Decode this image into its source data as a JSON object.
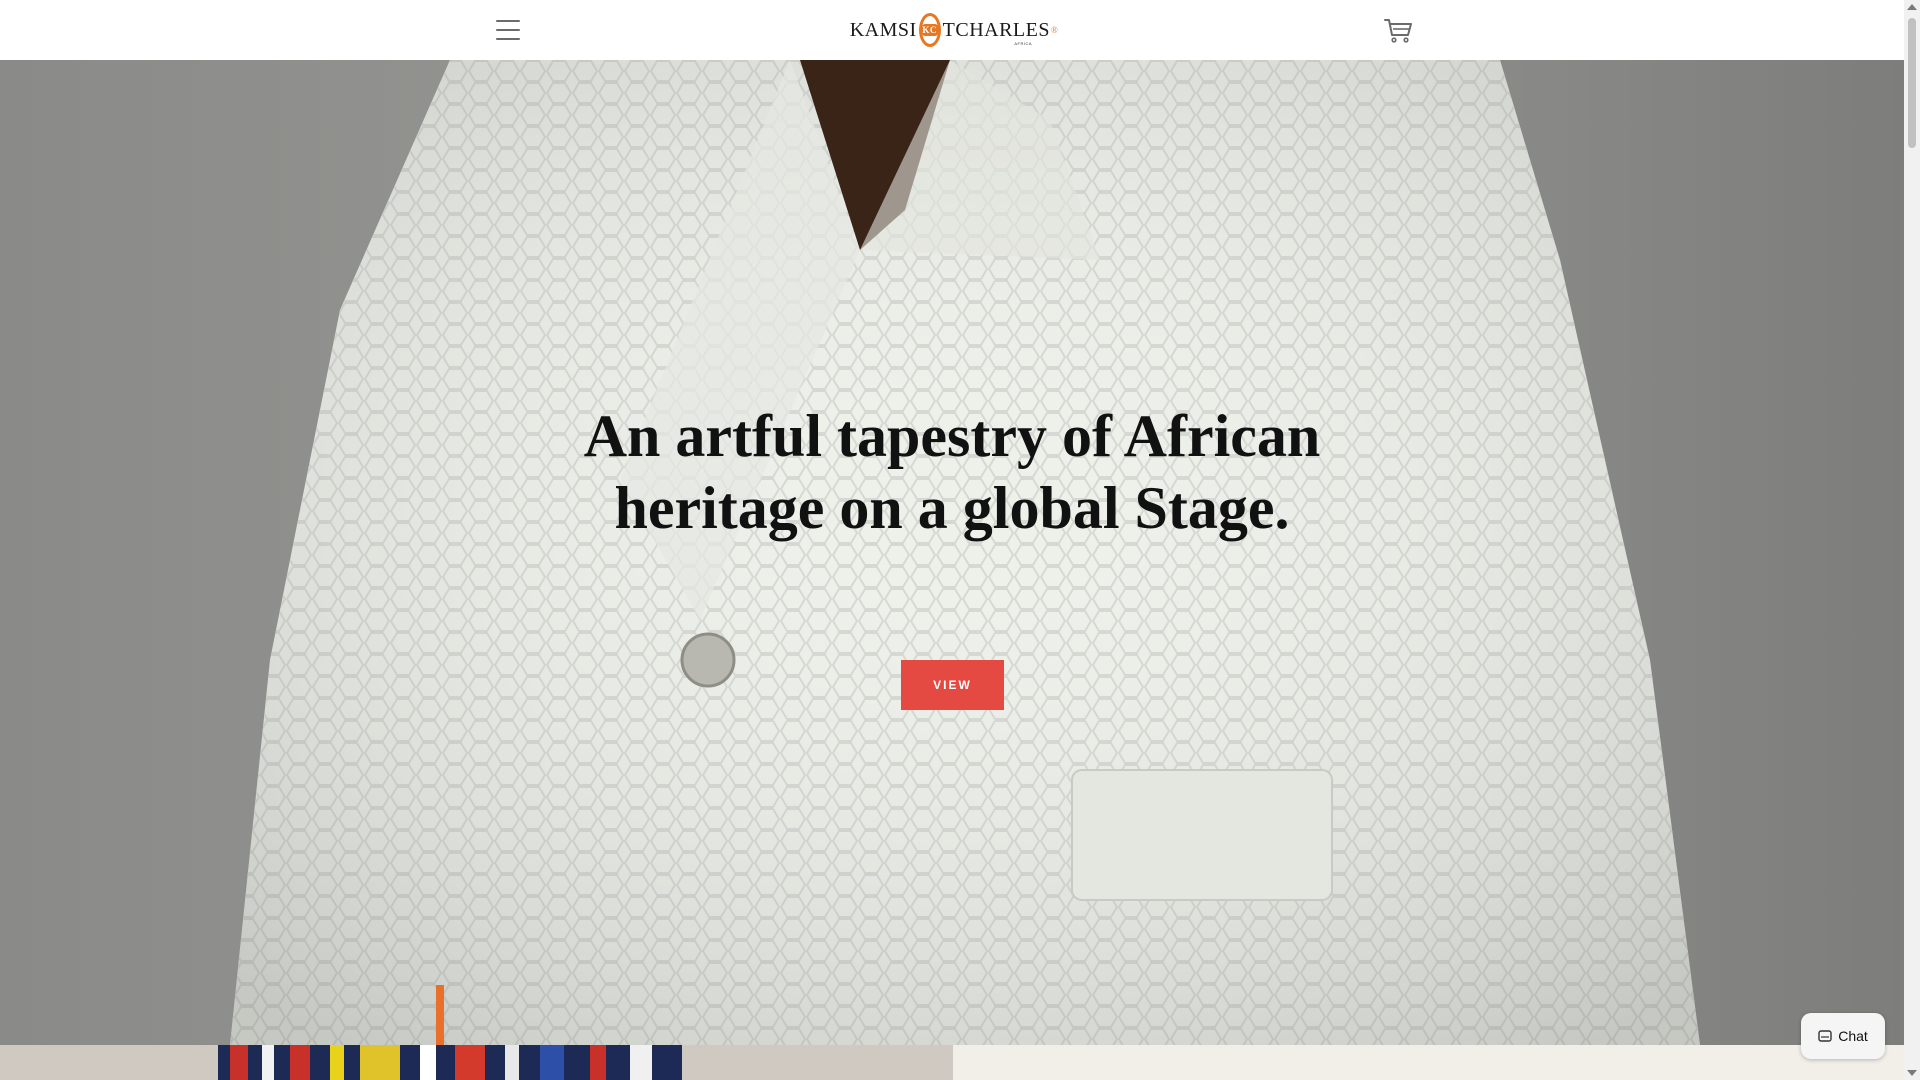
{
  "header": {
    "brand_left": "KAMSI",
    "brand_mark": "KC",
    "brand_right": "TCHARLES",
    "brand_reg": "®",
    "brand_sub": "AFRICA",
    "menu_icon": "hamburger-icon",
    "cart_icon": "cart-icon"
  },
  "hero": {
    "headline_line1": "An artful tapestry of African",
    "headline_line2": "heritage on a global Stage.",
    "cta_label": "VIEW",
    "cta_color": "#e44a41"
  },
  "chat": {
    "label": "Chat",
    "icon": "chat-icon"
  },
  "colors": {
    "accent": "#e87722",
    "cta": "#e44a41"
  }
}
